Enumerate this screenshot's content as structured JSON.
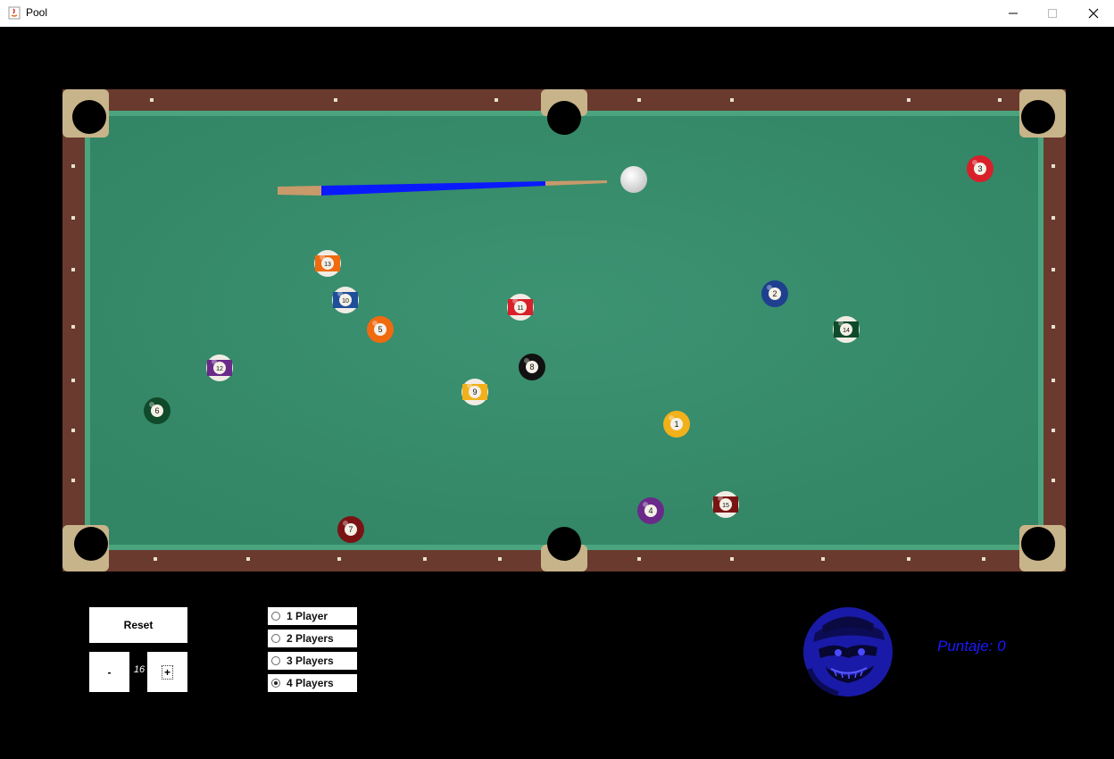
{
  "window": {
    "title": "Pool"
  },
  "controls": {
    "reset_label": "Reset",
    "minus_label": "-",
    "plus_label": "+",
    "ball_count": "16"
  },
  "players": {
    "options": [
      "1 Player",
      "2 Players",
      "3 Players",
      "4 Players"
    ],
    "selected": "4 Players"
  },
  "score": {
    "text": "Puntaje: 0"
  },
  "balls": [
    {
      "number": "1",
      "color": "#f2b01a",
      "striped": false
    },
    {
      "number": "2",
      "color": "#1f3f8f",
      "striped": false
    },
    {
      "number": "3",
      "color": "#d8202a",
      "striped": false
    },
    {
      "number": "4",
      "color": "#6a2a8a",
      "striped": false
    },
    {
      "number": "5",
      "color": "#f06a10",
      "striped": false
    },
    {
      "number": "6",
      "color": "#0f4a2a",
      "striped": false
    },
    {
      "number": "7",
      "color": "#7a1414",
      "striped": false
    },
    {
      "number": "8",
      "color": "#111111",
      "striped": false
    },
    {
      "number": "9",
      "color": "#f2b01a",
      "striped": true
    },
    {
      "number": "10",
      "color": "#1f4f9a",
      "striped": true
    },
    {
      "number": "11",
      "color": "#d8202a",
      "striped": true
    },
    {
      "number": "12",
      "color": "#6a2a8a",
      "striped": true
    },
    {
      "number": "13",
      "color": "#f06a10",
      "striped": true
    },
    {
      "number": "14",
      "color": "#0f4a2a",
      "striped": true
    },
    {
      "number": "15",
      "color": "#7a1414",
      "striped": true
    }
  ],
  "colors": {
    "felt": "#3a8f6e",
    "rail": "#6b3a2e",
    "corner": "#c8b48a",
    "cue_shaft": "#0a1aff",
    "cue_wood": "#c89a6a",
    "score": "#1a1aff"
  }
}
